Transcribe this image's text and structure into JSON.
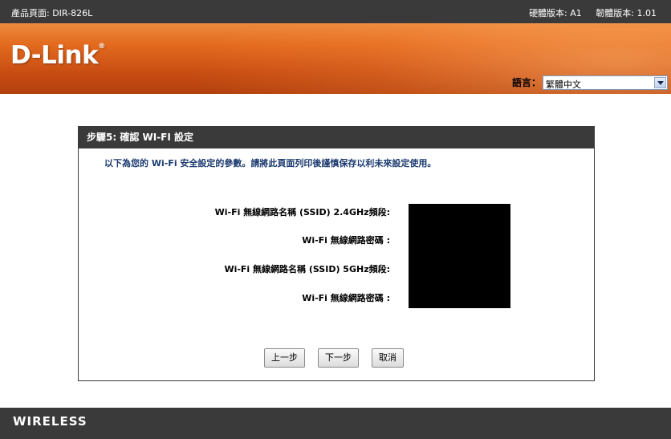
{
  "topbar": {
    "product": "產品頁面: DIR-826L",
    "hardware": "硬體版本: A1",
    "firmware": "韌體版本: 1.01"
  },
  "brand": {
    "logo": "D-Link",
    "registered": "®"
  },
  "language": {
    "label": "語言：",
    "selected": "繁體中文"
  },
  "panel": {
    "title": "步驟5: 確認 WI-FI 設定",
    "intro": "以下為您的 Wi-Fi 安全設定的參數。請將此頁面列印後謹慎保存以利未來設定使用。",
    "rows": [
      {
        "label": "Wi-Fi 無線網路名稱 (SSID) 2.4GHz頻段:"
      },
      {
        "label": "Wi-Fi 無線網路密碼 :"
      },
      {
        "label": "Wi-Fi 無線網路名稱 (SSID) 5GHz頻段:"
      },
      {
        "label": "Wi-Fi 無線網路密碼 :"
      }
    ]
  },
  "buttons": {
    "prev": "上一步",
    "next": "下一步",
    "cancel": "取消"
  },
  "footer": {
    "word": "WIRELESS"
  },
  "colors": {
    "dark_bar": "#3a3a3a",
    "banner_orange": "#e36a1f",
    "intro_text": "#1b3a6f"
  }
}
